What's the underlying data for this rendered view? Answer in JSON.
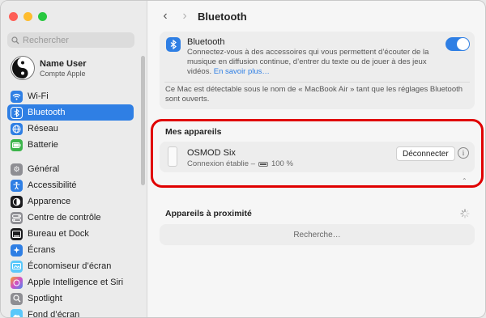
{
  "sidebar": {
    "search_placeholder": "Rechercher",
    "user": {
      "name": "Name User",
      "subtitle": "Compte Apple"
    },
    "items": [
      {
        "label": "Wi‑Fi",
        "icon": "wifi-icon",
        "color": "#2f7fe4",
        "active": false
      },
      {
        "label": "Bluetooth",
        "icon": "bluetooth-icon",
        "color": "#2f7fe4",
        "active": true
      },
      {
        "label": "Réseau",
        "icon": "globe-icon",
        "color": "#2f7fe4",
        "active": false
      },
      {
        "label": "Batterie",
        "icon": "battery-icon",
        "color": "#3cb44b",
        "active": false
      },
      {
        "label": "Général",
        "icon": "gear-icon",
        "color": "#8e8e93",
        "active": false
      },
      {
        "label": "Accessibilité",
        "icon": "accessibility-icon",
        "color": "#2f7fe4",
        "active": false
      },
      {
        "label": "Apparence",
        "icon": "appearance-icon",
        "color": "#1c1c1e",
        "active": false
      },
      {
        "label": "Centre de contrôle",
        "icon": "control-center-icon",
        "color": "#8e8e93",
        "active": false
      },
      {
        "label": "Bureau et Dock",
        "icon": "dock-icon",
        "color": "#1c1c1e",
        "active": false
      },
      {
        "label": "Écrans",
        "icon": "display-icon",
        "color": "#2f7fe4",
        "active": false
      },
      {
        "label": "Économiseur d’écran",
        "icon": "screensaver-icon",
        "color": "#5ac8fa",
        "active": false
      },
      {
        "label": "Apple Intelligence et Siri",
        "icon": "siri-icon",
        "color": "#b55bd6",
        "active": false
      },
      {
        "label": "Spotlight",
        "icon": "spotlight-icon",
        "color": "#8e8e93",
        "active": false
      },
      {
        "label": "Fond d’écran",
        "icon": "wallpaper-icon",
        "color": "#5ac8fa",
        "active": false
      }
    ]
  },
  "header": {
    "title": "Bluetooth"
  },
  "bluetooth": {
    "title": "Bluetooth",
    "description": "Connectez-vous à des accessoires qui vous permettent d’écouter de la musique en diffusion continue, d’entrer du texte ou de jouer à des jeux vidéos.",
    "link": "En savoir plus…",
    "enabled": true,
    "note": "Ce Mac est détectable sous le nom de « MacBook Air » tant que les réglages Bluetooth sont ouverts."
  },
  "my_devices": {
    "title": "Mes appareils",
    "devices": [
      {
        "name": "OSMOD Six",
        "status": "Connexion établie –",
        "battery": "100 %",
        "battery_level": 1.0,
        "action": "Déconnecter"
      }
    ]
  },
  "nearby": {
    "title": "Appareils à proximité",
    "status": "Recherche…"
  },
  "colors": {
    "accent": "#2f7fe4",
    "highlight": "#e00000"
  }
}
